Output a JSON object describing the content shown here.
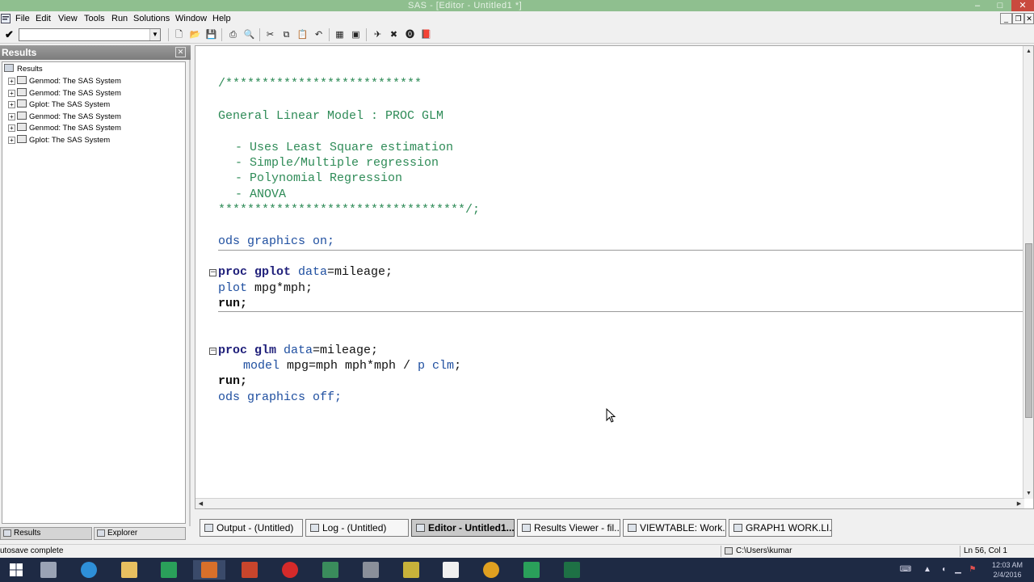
{
  "window": {
    "title": "SAS - [Editor - Untitled1 *]",
    "minimize": "–",
    "maximize": "□",
    "close": "✕"
  },
  "menu": {
    "items": [
      {
        "label": "File"
      },
      {
        "label": "Edit"
      },
      {
        "label": "View"
      },
      {
        "label": "Tools"
      },
      {
        "label": "Run"
      },
      {
        "label": "Solutions"
      },
      {
        "label": "Window"
      },
      {
        "label": "Help"
      }
    ],
    "mdi_min": "_",
    "mdi_restore": "❐",
    "mdi_close": "✕"
  },
  "toolbar": {
    "command_value": "",
    "icons": [
      "new-icon",
      "open-icon",
      "save-icon",
      "print-icon",
      "print-preview-icon",
      "cut-icon",
      "copy-icon",
      "paste-icon",
      "undo-icon",
      "libraries-icon",
      "explorer-icon",
      "submit-icon",
      "clear-icon",
      "help-icon",
      "sas-help-icon"
    ]
  },
  "results_pane": {
    "header": "Results",
    "close_icon": "✕",
    "root": "Results",
    "items": [
      {
        "label": "Genmod:  The SAS System"
      },
      {
        "label": "Genmod:  The SAS System"
      },
      {
        "label": "Gplot:  The SAS System"
      },
      {
        "label": "Genmod:  The SAS System"
      },
      {
        "label": "Genmod:  The SAS System"
      },
      {
        "label": "Gplot:  The SAS System"
      }
    ],
    "tabs": [
      {
        "label": "Results"
      },
      {
        "label": "Explorer"
      }
    ]
  },
  "editor": {
    "lines": {
      "comment_open": "/***************************",
      "heading": "General Linear Model : PROC GLM",
      "bullet1": "- Uses Least Square estimation",
      "bullet2": "- Simple/Multiple regression",
      "bullet3": "- Polynomial Regression",
      "bullet4": "- ANOVA",
      "comment_close": "**********************************/;",
      "ods_on": "ods graphics on;",
      "gplot_kw1": "proc gplot ",
      "gplot_kw2": "data",
      "gplot_rest": "=mileage;",
      "plot_kw": "plot ",
      "plot_rest": "mpg*mph;",
      "run1": "run;",
      "glm_kw1": "proc glm ",
      "glm_kw2": "data",
      "glm_rest": "=mileage;",
      "model_kw": "model ",
      "model_rest": "mpg=mph mph*mph / ",
      "model_opt": "p clm",
      "model_end": ";",
      "run2": "run;",
      "ods_off": "ods graphics off;"
    },
    "fold_symbol": "−"
  },
  "window_tabs": [
    {
      "label": "Output - (Untitled)",
      "active": false
    },
    {
      "label": "Log - (Untitled)",
      "active": false
    },
    {
      "label": "Editor - Untitled1...",
      "active": true
    },
    {
      "label": "Results Viewer - fil...",
      "active": false
    },
    {
      "label": "VIEWTABLE: Work....",
      "active": false
    },
    {
      "label": "GRAPH1  WORK.LI...",
      "active": false
    }
  ],
  "status": {
    "message": "utosave complete",
    "path": "C:\\Users\\kumar",
    "position": "Ln 56, Col 1"
  },
  "taskbar": {
    "apps": [
      {
        "name": "start-icon",
        "color": "#ffffff"
      },
      {
        "name": "task-view-icon",
        "color": "#9aa3b5"
      },
      {
        "name": "internet-explorer-icon",
        "color": "#2e8fd8"
      },
      {
        "name": "file-explorer-icon",
        "color": "#e8c060"
      },
      {
        "name": "camtasia-icon",
        "color": "#2aa05a"
      },
      {
        "name": "sas-app-icon",
        "color": "#d8702a"
      },
      {
        "name": "powerpoint-icon",
        "color": "#c8452c"
      },
      {
        "name": "opera-icon",
        "color": "#d52a2a"
      },
      {
        "name": "app-u-icon",
        "color": "#3a8c5c"
      },
      {
        "name": "app-tool-icon",
        "color": "#8a8f9a"
      },
      {
        "name": "app-design-icon",
        "color": "#c8b23a"
      },
      {
        "name": "camtasia-studio-icon",
        "color": "#f0f0f0"
      },
      {
        "name": "chrome-icon",
        "color": "#e0a020"
      },
      {
        "name": "camtasia-recorder-icon",
        "color": "#2aa05a"
      },
      {
        "name": "excel-icon",
        "color": "#1e7145"
      }
    ],
    "tray_up": "▲",
    "clock_time": "12:03 AM",
    "clock_date": "2/4/2016"
  }
}
